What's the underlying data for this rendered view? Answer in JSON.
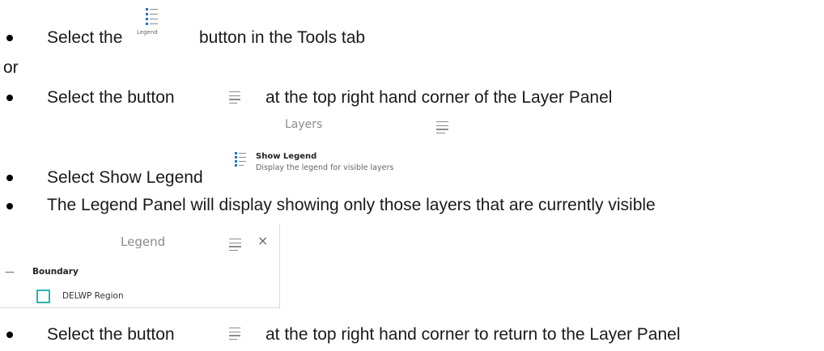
{
  "steps": {
    "step1_prefix": "Select the",
    "step1_suffix": "button in the Tools tab",
    "or_text": "or",
    "step2_prefix": "Select the button",
    "step2_suffix": "at the top right hand corner of the Layer Panel",
    "step3": "Select Show Legend",
    "step4": "The Legend Panel will display showing only those layers that are currently visible",
    "step5_prefix": "Select the button",
    "step5_suffix": "at the top right hand corner to return to the Layer Panel"
  },
  "tools_legend_button": {
    "label": "Legend",
    "icon": "legend-icon"
  },
  "layers_header": {
    "title": "Layers",
    "menu_icon": "hamburger-menu-icon"
  },
  "show_legend_menu": {
    "title": "Show Legend",
    "description": "Display the legend for visible layers",
    "icon": "legend-icon"
  },
  "legend_panel": {
    "title": "Legend",
    "menu_icon": "hamburger-menu-icon",
    "close_icon": "close-icon",
    "close_glyph": "×",
    "collapse_glyph": "—",
    "group_name": "Boundary",
    "layer_name": "DELWP Region",
    "swatch_color": "#2bb3b1"
  }
}
